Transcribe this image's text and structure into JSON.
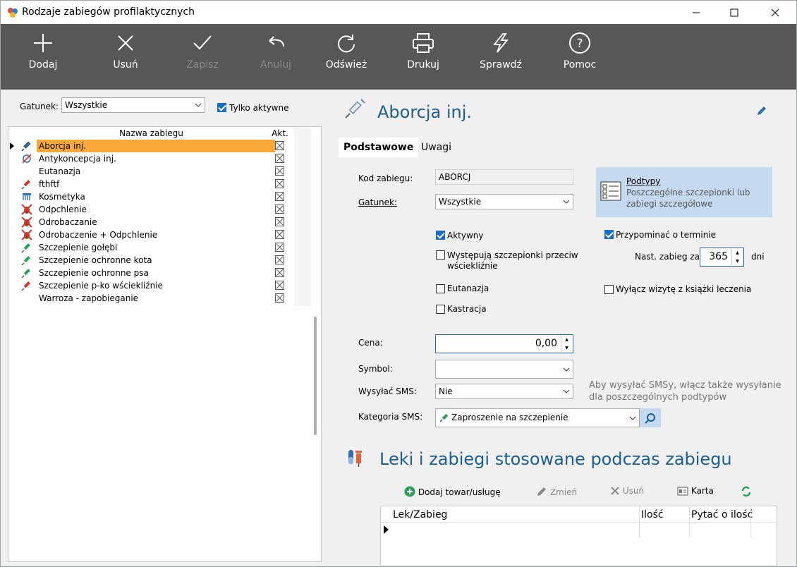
{
  "window": {
    "title": "Rodzaje zabiegów profilaktycznych"
  },
  "toolbar": {
    "add": "Dodaj",
    "delete": "Usuń",
    "save": "Zapisz",
    "cancel": "Anuluj",
    "refresh": "Odśwież",
    "print": "Drukuj",
    "check": "Sprawdź",
    "help": "Pomoc"
  },
  "filter": {
    "species_label": "Gatunek:",
    "species_value": "Wszystkie",
    "active_only_label": "Tylko aktywne",
    "active_only_checked": true
  },
  "list": {
    "col_name": "Nazwa zabiegu",
    "col_active": "Akt.",
    "rows": [
      {
        "name": "Aborcja inj.",
        "icon": "syringe-icon",
        "selected": true
      },
      {
        "name": "Antykoncepcja inj.",
        "icon": "contraception-icon"
      },
      {
        "name": "Eutanazja",
        "icon": ""
      },
      {
        "name": "fthftf",
        "icon": "syringe-red-icon"
      },
      {
        "name": "Kosmetyka",
        "icon": "comb-icon"
      },
      {
        "name": "Odpchlenie",
        "icon": "flea-icon"
      },
      {
        "name": "Odrobaczanie",
        "icon": "flea-icon"
      },
      {
        "name": "Odrobaczenie + Odpchlenie",
        "icon": "flea-icon"
      },
      {
        "name": "Szczepienie gołębi",
        "icon": "syringe-green-icon"
      },
      {
        "name": "Szczepienie ochronne kota",
        "icon": "syringe-green-icon"
      },
      {
        "name": "Szczepienie ochronne psa",
        "icon": "syringe-green-icon"
      },
      {
        "name": "Szczepienie p-ko wściekliźnie",
        "icon": "syringe-red-icon"
      },
      {
        "name": "Warroza - zapobieganie",
        "icon": ""
      }
    ]
  },
  "detail": {
    "title": "Aborcja inj.",
    "tabs": [
      "Podstawowe",
      "Uwagi"
    ],
    "code_label": "Kod zabiegu:",
    "code_value": "ABORCJ",
    "species_label": "Gatunek:",
    "species_value": "Wszystkie",
    "podtypy_title": "Podtypy",
    "podtypy_desc1": "Poszczególne szczepionki lub",
    "podtypy_desc2": "zabiegi szczegółowe",
    "active_label": "Aktywny",
    "rabies_label1": "Występują szczepionki przeciw",
    "rabies_label2": "wściekliźnie",
    "euthanasia_label": "Eutanazja",
    "castration_label": "Kastracja",
    "remind_label": "Przypominać o terminie",
    "next_label": "Nast. zabieg za:",
    "next_value": "365",
    "days_label": "dni",
    "exclude_label": "Wyłącz wizytę z książki leczenia",
    "price_label": "Cena:",
    "price_value": "0,00",
    "symbol_label": "Symbol:",
    "symbol_value": "",
    "sms_label": "Wysyłać SMS:",
    "sms_value": "Nie",
    "sms_hint1": "Aby wysyłać SMSy, włącz także wysyłanie",
    "sms_hint2": "dla poszczególnych podtypów",
    "smscat_label": "Kategoria SMS:",
    "smscat_value": "Zaproszenie na szczepienie"
  },
  "meds": {
    "title": "Leki i zabiegi stosowane podczas zabiegu",
    "add": "Dodaj towar/usługę",
    "edit": "Zmień",
    "delete": "Usuń",
    "card": "Karta",
    "col_item": "Lek/Zabieg",
    "col_qty": "Ilość",
    "col_ask": "Pytać o ilość"
  }
}
